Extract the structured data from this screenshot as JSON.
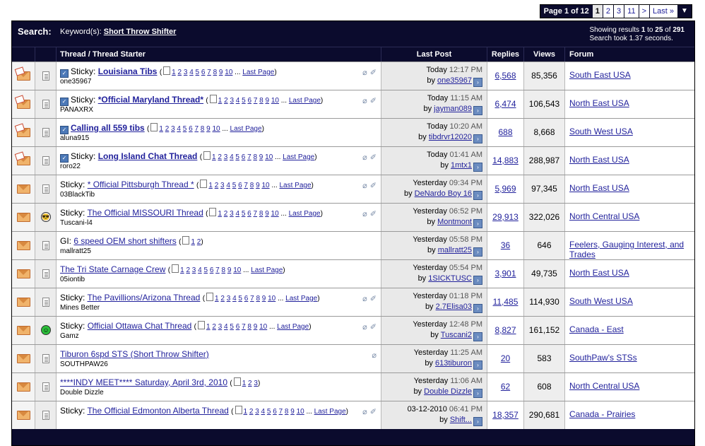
{
  "pagination": {
    "info": "Page 1 of 12",
    "current": "1",
    "pages": [
      "2",
      "3",
      "11"
    ],
    "next": ">",
    "last": "Last »"
  },
  "search": {
    "title": "Search:",
    "keyword_label": "Keyword(s):",
    "keyword": "Short Throw Shifter",
    "results_line1_prefix": "Showing results",
    "results_from": "1",
    "results_to": "25",
    "results_total": "291",
    "results_line1": "Showing results 1 to 25 of 291",
    "results_line2": "Search took 1.37 seconds."
  },
  "columns": {
    "thread": "Thread / Thread Starter",
    "last_post": "Last Post",
    "replies": "Replies",
    "views": "Views",
    "forum": "Forum"
  },
  "threads": [
    {
      "hot": true,
      "post_icon": "doc",
      "check": true,
      "prefix": "Sticky:",
      "title": "Louisiana Tibs",
      "bold": true,
      "pages": "1 2 3 4 5 6 7 8 9 10",
      "last_page": "Last Page",
      "starter": "one35967",
      "attach": true,
      "subscribed": true,
      "lp_date": "Today",
      "lp_time": "12:17 PM",
      "lp_by_label": "by",
      "lp_user": "one35967",
      "replies": "6,568",
      "views": "85,356",
      "forum": "South East USA"
    },
    {
      "hot": true,
      "post_icon": "doc",
      "check": true,
      "prefix": "Sticky:",
      "title": "*Official Maryland Thread*",
      "bold": true,
      "pages": "1 2 3 4 5 6 7 8 9 10",
      "last_page": "Last Page",
      "starter": "PANAXRX",
      "attach": true,
      "subscribed": true,
      "lp_date": "Today",
      "lp_time": "11:15 AM",
      "lp_by_label": "by",
      "lp_user": "jayman089",
      "replies": "6,474",
      "views": "106,543",
      "forum": "North East USA"
    },
    {
      "hot": true,
      "post_icon": "doc",
      "check": true,
      "prefix": "",
      "title": "Calling all 559 tibs",
      "bold": true,
      "pages": "1 2 3 4 5 6 7 8 9 10",
      "last_page": "Last Page",
      "starter": "aluna915",
      "attach": false,
      "subscribed": false,
      "lp_date": "Today",
      "lp_time": "10:20 AM",
      "lp_by_label": "by",
      "lp_user": "tibdrvr12020",
      "replies": "688",
      "views": "8,668",
      "forum": "South West USA"
    },
    {
      "hot": true,
      "post_icon": "doc",
      "check": true,
      "prefix": "Sticky:",
      "title": "Long Island Chat Thread",
      "bold": true,
      "pages": "1 2 3 4 5 6 7 8 9 10",
      "last_page": "Last Page",
      "starter": "roro22",
      "attach": true,
      "subscribed": true,
      "lp_date": "Today",
      "lp_time": "01:41 AM",
      "lp_by_label": "by",
      "lp_user": "1mtx1",
      "replies": "14,883",
      "views": "288,987",
      "forum": "North East USA"
    },
    {
      "hot": false,
      "post_icon": "doc",
      "check": false,
      "prefix": "Sticky:",
      "title": "* Official Pittsburgh Thread *",
      "bold": false,
      "pages": "1 2 3 4 5 6 7 8 9 10",
      "last_page": "Last Page",
      "starter": "03BlackTib",
      "attach": true,
      "subscribed": true,
      "lp_date": "Yesterday",
      "lp_time": "09:34 PM",
      "lp_by_label": "by",
      "lp_user": "DeNardo Boy 16",
      "replies": "5,969",
      "views": "97,345",
      "forum": "North East USA"
    },
    {
      "hot": false,
      "post_icon": "cool",
      "check": false,
      "prefix": "Sticky:",
      "title": "The Official MISSOURI Thread",
      "bold": false,
      "pages": "1 2 3 4 5 6 7 8 9 10",
      "last_page": "Last Page",
      "starter": "Tuscani-l4",
      "attach": true,
      "subscribed": true,
      "lp_date": "Yesterday",
      "lp_time": "06:52 PM",
      "lp_by_label": "by",
      "lp_user": "Montmont",
      "replies": "29,913",
      "views": "322,026",
      "forum": "North Central USA"
    },
    {
      "hot": false,
      "post_icon": "doc",
      "check": false,
      "prefix": "GI:",
      "title": "6 speed OEM short shifters",
      "bold": false,
      "pages": "1 2",
      "last_page": "",
      "starter": "mallratt25",
      "attach": false,
      "subscribed": false,
      "lp_date": "Yesterday",
      "lp_time": "05:58 PM",
      "lp_by_label": "by",
      "lp_user": "mallratt25",
      "replies": "36",
      "views": "646",
      "forum": "Feelers, Gauging Interest, and Trades"
    },
    {
      "hot": false,
      "post_icon": "doc",
      "check": false,
      "prefix": "",
      "title": "The Tri State Carnage Crew",
      "bold": false,
      "pages": "1 2 3 4 5 6 7 8 9 10",
      "last_page": "Last Page",
      "starter": "05iontib",
      "attach": false,
      "subscribed": false,
      "lp_date": "Yesterday",
      "lp_time": "05:54 PM",
      "lp_by_label": "by",
      "lp_user": "1SICKTUSC",
      "replies": "3,901",
      "views": "49,735",
      "forum": "North East USA"
    },
    {
      "hot": false,
      "post_icon": "doc",
      "check": false,
      "prefix": "Sticky:",
      "title": "The Pavillions/Arizona Thread",
      "bold": false,
      "pages": "1 2 3 4 5 6 7 8 9 10",
      "last_page": "Last Page",
      "starter": "Mines Better",
      "attach": true,
      "subscribed": true,
      "lp_date": "Yesterday",
      "lp_time": "01:18 PM",
      "lp_by_label": "by",
      "lp_user": "2.7Elisa03",
      "replies": "11,485",
      "views": "114,930",
      "forum": "South West USA"
    },
    {
      "hot": false,
      "post_icon": "green",
      "check": false,
      "prefix": "Sticky:",
      "title": "Official Ottawa Chat Thread",
      "bold": false,
      "pages": "1 2 3 4 5 6 7 8 9 10",
      "last_page": "Last Page",
      "starter": "Gamz",
      "attach": true,
      "subscribed": true,
      "lp_date": "Yesterday",
      "lp_time": "12:48 PM",
      "lp_by_label": "by",
      "lp_user": "Tuscani2",
      "replies": "8,827",
      "views": "161,152",
      "forum": "Canada - East"
    },
    {
      "hot": false,
      "post_icon": "doc",
      "check": false,
      "prefix": "",
      "title": "Tiburon 6spd STS (Short Throw Shifter)",
      "bold": false,
      "pages": "",
      "last_page": "",
      "starter": "SOUTHPAW26",
      "attach": true,
      "subscribed": false,
      "lp_date": "Yesterday",
      "lp_time": "11:25 AM",
      "lp_by_label": "by",
      "lp_user": "613tiburon",
      "replies": "20",
      "views": "583",
      "forum": "SouthPaw's STSs"
    },
    {
      "hot": false,
      "post_icon": "doc",
      "check": false,
      "prefix": "",
      "title": "****INDY MEET**** Saturday, April 3rd, 2010",
      "bold": false,
      "pages": "1 2 3",
      "last_page": "",
      "starter": "Double Dizzle",
      "attach": false,
      "subscribed": false,
      "lp_date": "Yesterday",
      "lp_time": "11:06 AM",
      "lp_by_label": "by",
      "lp_user": "Double Dizzle",
      "replies": "62",
      "views": "608",
      "forum": "North Central USA"
    },
    {
      "hot": false,
      "post_icon": "doc",
      "check": false,
      "prefix": "Sticky:",
      "title": "The Official Edmonton Alberta Thread",
      "bold": false,
      "pages": "1 2 3 4 5 6 7 8 9 10",
      "last_page": "Last Page",
      "starter": "",
      "attach": true,
      "subscribed": true,
      "lp_date": "03-12-2010",
      "lp_time": "06:41 PM",
      "lp_by_label": "by",
      "lp_user": "Shift...",
      "replies": "18,357",
      "views": "290,681",
      "forum": "Canada - Prairies"
    }
  ],
  "icons": {
    "attach": "paperclip-icon",
    "subscribed": "pin-icon",
    "goto": "arrow-right-icon",
    "pages": "multipage-icon",
    "menu": "triangle-down-icon"
  }
}
